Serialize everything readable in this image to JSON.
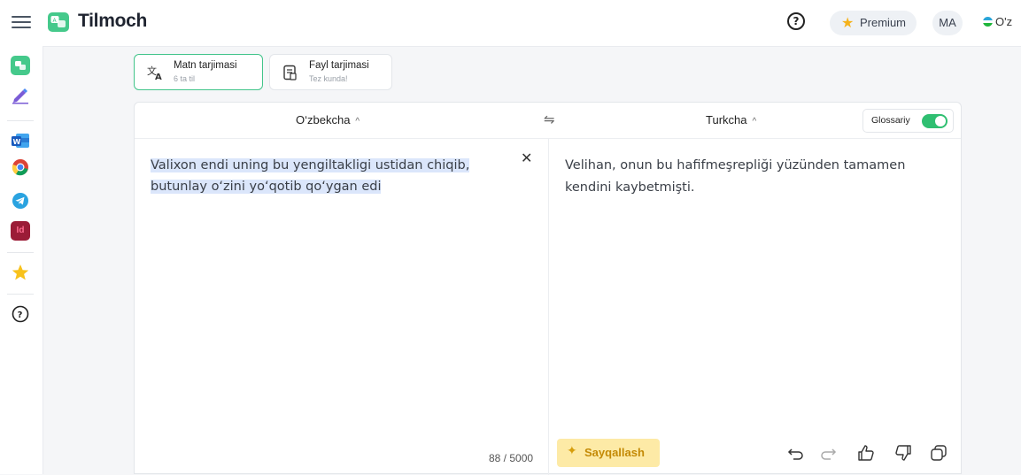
{
  "app": {
    "name": "Tilmoch"
  },
  "topbar": {
    "help_icon": "question-circle-icon",
    "premium_label": "Premium",
    "avatar_initials": "MA",
    "ui_language": "O'z"
  },
  "sidebar": {
    "items": [
      {
        "name": "tilmoch-app",
        "icon": "translate-logo-icon"
      },
      {
        "name": "edit",
        "icon": "pencil-icon"
      },
      {
        "name": "word",
        "icon": "word-icon"
      },
      {
        "name": "chrome",
        "icon": "chrome-icon"
      },
      {
        "name": "telegram",
        "icon": "telegram-icon"
      },
      {
        "name": "indesign",
        "icon": "indesign-icon",
        "label": "Id"
      },
      {
        "name": "favorites",
        "icon": "star-icon"
      },
      {
        "name": "help",
        "icon": "question-circle-icon"
      }
    ]
  },
  "modes": [
    {
      "title": "Matn tarjimasi",
      "subtitle": "6 ta til",
      "active": true,
      "icon": "translate-icon"
    },
    {
      "title": "Fayl tarjimasi",
      "subtitle": "Tez kunda!",
      "active": false,
      "icon": "file-icon"
    }
  ],
  "translator": {
    "source_lang": "O‘zbekcha",
    "target_lang": "Turkcha",
    "glossary_label": "Glossariy",
    "glossary_on": true,
    "source_text": "Valixon endi uning bu yengiltakligi ustidan chiqib, butunlay o‘zini yo‘qotib qo‘ygan edi",
    "target_text": "Velihan, onun bu hafifmeşrepliği yüzünden tamamen kendini kaybetmişti.",
    "char_count": "88 / 5000",
    "polish_label": "Sayqallash"
  },
  "colors": {
    "brand": "#45c98b",
    "toggle_on": "#2fbf71",
    "polish_bg": "#fdeaa6",
    "selection": "#dbe6fb"
  }
}
